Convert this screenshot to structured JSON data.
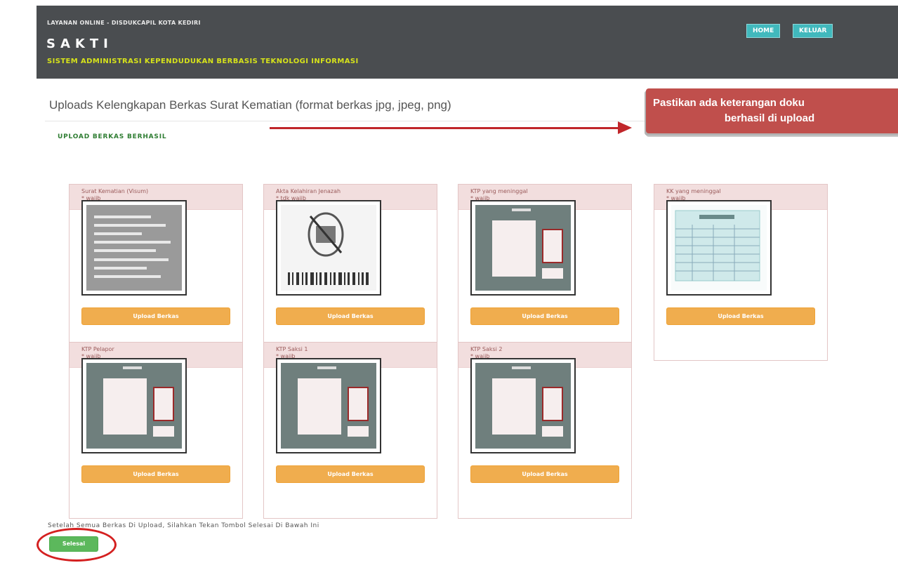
{
  "header": {
    "tagline": "LAYANAN ONLINE - DISDUKCAPIL KOTA KEDIRI",
    "brand": "SAKTI",
    "subtitle": "SISTEM ADMINISTRASI KEPENDUDUKAN BERBASIS TEKNOLOGI INFORMASI",
    "home_label": "HOME",
    "keluar_label": "KELUAR",
    "accent_color": "#41b9bd"
  },
  "main": {
    "title": "Uploads Kelengkapan Berkas Surat Kematian (format berkas jpg, jpeg, png)",
    "success_message": "UPLOAD BERKAS BERHASIL",
    "cards": [
      {
        "name": "Surat Kematian (Visum)",
        "requirement": "* wajib",
        "button": "Upload Berkas",
        "thumbnail": "scanned-document-icon"
      },
      {
        "name": "Akta Kelahiran Jenazah",
        "requirement": "* tdk wajib",
        "button": "Upload Berkas",
        "thumbnail": "no-photo-barcode-icon"
      },
      {
        "name": "KTP yang meninggal",
        "requirement": "* wajib",
        "button": "Upload Berkas",
        "thumbnail": "ktp-card-icon"
      },
      {
        "name": "KK yang meninggal",
        "requirement": "* wajib",
        "button": "Upload Berkas",
        "thumbnail": "family-card-icon"
      },
      {
        "name": "KTP Pelapor",
        "requirement": "* wajib",
        "button": "Upload Berkas",
        "thumbnail": "ktp-card-icon"
      },
      {
        "name": "KTP Saksi 1",
        "requirement": "* wajib",
        "button": "Upload Berkas",
        "thumbnail": "ktp-card-icon"
      },
      {
        "name": "KTP Saksi 2",
        "requirement": "* wajib",
        "button": "Upload Berkas",
        "thumbnail": "ktp-card-icon"
      }
    ],
    "footer_text": "Setelah Semua Berkas Di Upload, Silahkan Tekan Tombol Selesai Di Bawah Ini",
    "finish_button": "Selesai"
  },
  "annotation": {
    "callout_line1": "Pastikan ada keterangan doku",
    "callout_line2": "berhasil di upload",
    "callout_color": "#c04f4c",
    "arrow_color": "#c0262a"
  }
}
